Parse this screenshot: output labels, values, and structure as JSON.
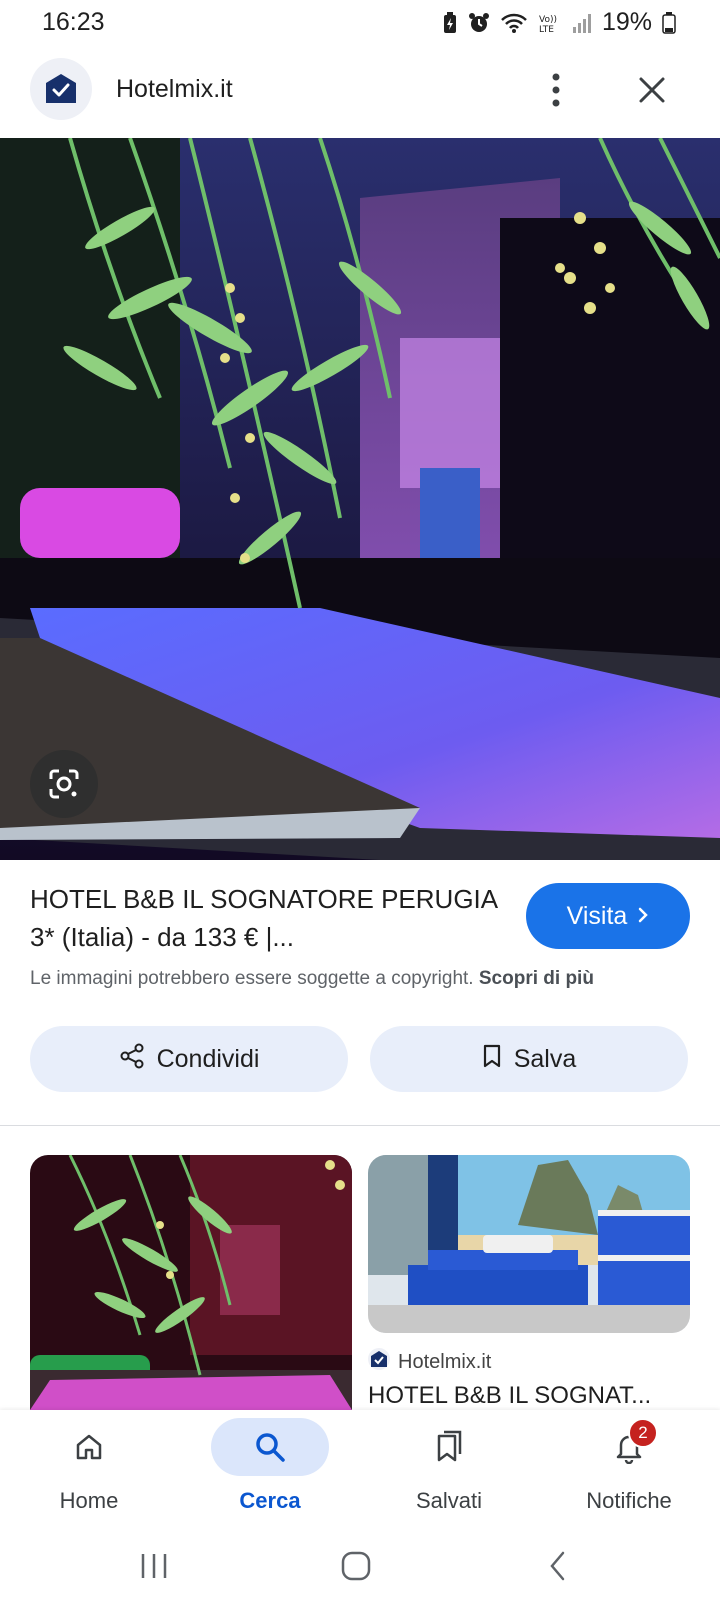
{
  "status_bar": {
    "time": "16:23",
    "battery_text": "19%",
    "icons": [
      "battery-saver-icon",
      "alarm-icon",
      "wifi-icon",
      "volte-icon",
      "signal-icon",
      "battery-icon"
    ]
  },
  "header": {
    "site_name": "Hotelmix.it",
    "logo_icon": "hotelmix-logo-icon",
    "more_icon": "more-vert-icon",
    "close_icon": "close-icon"
  },
  "hero": {
    "image_alt": "Hotel pool at night under hanging pepper-tree branches",
    "lens_icon": "google-lens-icon"
  },
  "result": {
    "title": "HOTEL B&B IL SOGNATORE PERUGIA 3* (Italia) - da 133 € |...",
    "visit_label": "Visita",
    "copyright_text": "Le immagini potrebbero essere soggette a copyright.",
    "learn_more": "Scopri di più",
    "share_label": "Condividi",
    "save_label": "Salva"
  },
  "related": [
    {
      "image_alt": "Pool at night with hanging branches"
    },
    {
      "image_alt": "Blue bedroom with bunk beds and mural",
      "source": "Hotelmix.it",
      "title": "HOTEL B&B IL SOGNAT..."
    }
  ],
  "bottom_nav": {
    "items": [
      {
        "label": "Home",
        "icon": "home-icon"
      },
      {
        "label": "Cerca",
        "icon": "search-icon",
        "active": true
      },
      {
        "label": "Salvati",
        "icon": "bookmarks-icon"
      },
      {
        "label": "Notifiche",
        "icon": "bell-icon",
        "badge": "2"
      }
    ]
  },
  "colors": {
    "accent": "#1a73e8",
    "chip_bg": "#e8eefa",
    "active_nav": "#0b57d0",
    "badge": "#c5221f"
  }
}
